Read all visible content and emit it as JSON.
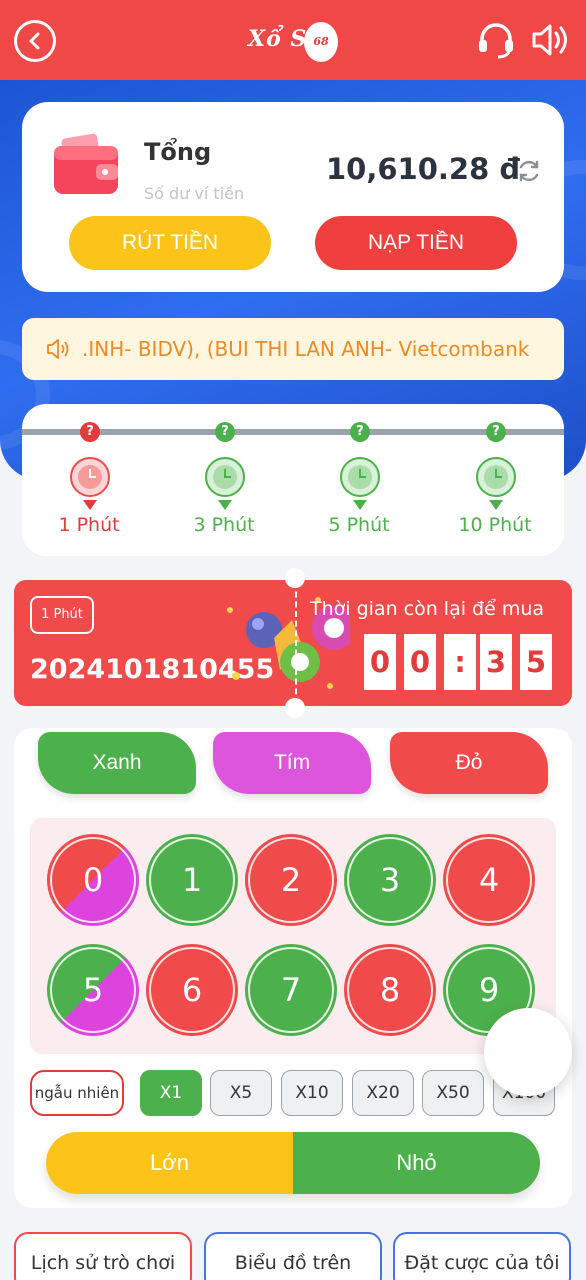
{
  "header": {
    "logo_text": "Xổ Số",
    "logo_badge": "68",
    "icons": [
      "back-icon",
      "headset-icon",
      "speaker-icon"
    ]
  },
  "wallet": {
    "title": "Tổng",
    "subtitle": "Số dư ví tiền",
    "balance": "10,610.28 đ",
    "withdraw_label": "RÚT TIỀN",
    "deposit_label": "NẠP TIỀN"
  },
  "notice": {
    "text": ".INH- BIDV),  (BUI THI LAN ANH- Vietcombank"
  },
  "timers": [
    {
      "label": "1 Phút",
      "badge": "?",
      "active": true
    },
    {
      "label": "3 Phút",
      "badge": "?",
      "active": false
    },
    {
      "label": "5 Phút",
      "badge": "?",
      "active": false
    },
    {
      "label": "10 Phút",
      "badge": "?",
      "active": false
    }
  ],
  "game": {
    "period_badge": "1 Phút",
    "period_id": "2024101810455",
    "remaining_label": "Thời gian còn lại để mua",
    "countdown": [
      "0",
      "0",
      ":",
      "3",
      "5"
    ]
  },
  "colors": {
    "green_label": "Xanh",
    "violet_label": "Tím",
    "red_label": "Đỏ",
    "green": "#4cb14c",
    "violet": "#dd55dd",
    "red": "#f04a4a",
    "yellow": "#fcc419"
  },
  "numbers": [
    "0",
    "1",
    "2",
    "3",
    "4",
    "5",
    "6",
    "7",
    "8",
    "9"
  ],
  "multipliers": {
    "random_label": "ngẫu nhiên",
    "options": [
      "X1",
      "X5",
      "X10",
      "X20",
      "X50",
      "X100"
    ],
    "selected": "X1"
  },
  "bigsmall": {
    "big_label": "Lớn",
    "small_label": "Nhỏ"
  },
  "bottom_tabs": [
    "Lịch sử trò chơi",
    "Biểu đồ trên",
    "Đặt cược của tôi"
  ]
}
